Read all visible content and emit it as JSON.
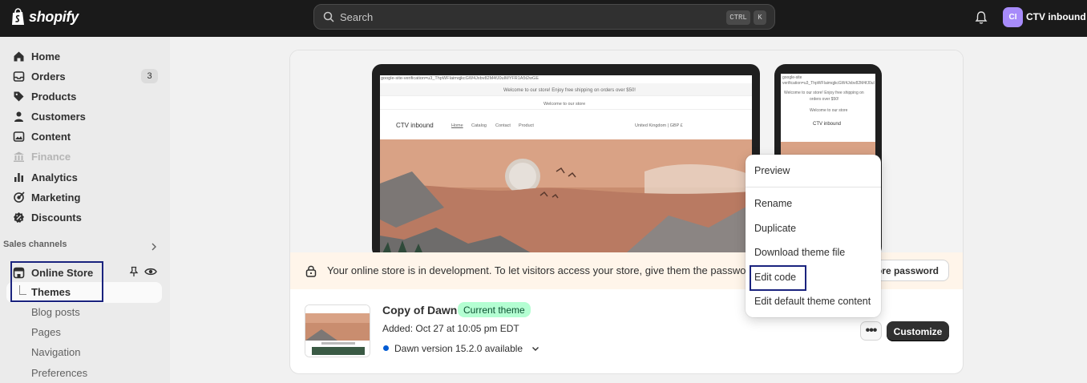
{
  "topbar": {
    "brand": "shopify",
    "search_placeholder": "Search",
    "shortcut_ctrl": "CTRL",
    "shortcut_k": "K",
    "avatar_initials": "CI",
    "store_name": "CTV inbound"
  },
  "sidebar": {
    "items": [
      {
        "label": "Home",
        "icon": "home-icon"
      },
      {
        "label": "Orders",
        "icon": "inbox-icon",
        "badge": "3"
      },
      {
        "label": "Products",
        "icon": "tag-icon"
      },
      {
        "label": "Customers",
        "icon": "person-icon"
      },
      {
        "label": "Content",
        "icon": "image-icon"
      },
      {
        "label": "Finance",
        "icon": "bank-icon",
        "disabled": true
      },
      {
        "label": "Analytics",
        "icon": "bar-chart-icon"
      },
      {
        "label": "Marketing",
        "icon": "target-icon"
      },
      {
        "label": "Discounts",
        "icon": "discount-icon"
      }
    ],
    "sales_channels_label": "Sales channels",
    "online_store_label": "Online Store",
    "sub_items": [
      "Themes",
      "Blog posts",
      "Pages",
      "Navigation",
      "Preferences"
    ]
  },
  "preview": {
    "laptop": {
      "verification": "google-site-verification=u3_ThpWFIaimqjkcGW4Jxbv82M4fJ0uIMYFR1A5t2wGE",
      "announcement": "Welcome to our store! Enjoy free shipping on orders over $50!",
      "welcome": "Welcome to our store",
      "store_title": "CTV inbound",
      "nav": [
        "Home",
        "Catalog",
        "Contact",
        "Product"
      ],
      "region": "United Kingdom | GBP £"
    },
    "phone": {
      "verification_1": "google-site",
      "verification_2": "verification=u3_ThpWFIaimqjkcGW4Jxbv82M4fJ0uI",
      "announcement_1": "Welcome to our store! Enjoy free shipping on",
      "announcement_2": "orders over $50!",
      "welcome": "Welcome to our store",
      "store_title": "CTV inbound"
    }
  },
  "alert": {
    "text": "Your online store is in development. To let visitors access your store, give them the password.",
    "button": "tore password"
  },
  "theme": {
    "name": "Copy of Dawn",
    "badge": "Current theme",
    "added": "Added: Oct 27 at 10:05 pm EDT",
    "version": "Dawn version 15.2.0 available",
    "more_label": "•••",
    "customize": "Customize"
  },
  "menu": {
    "items": [
      "Preview",
      "Rename",
      "Duplicate",
      "Download theme file",
      "Edit code",
      "Edit default theme content"
    ]
  },
  "colors": {
    "topbar": "#1a1a1a",
    "accent_badge": "#b4fed2",
    "avatar": "#a78bfa",
    "highlight_box": "#1a237e"
  }
}
